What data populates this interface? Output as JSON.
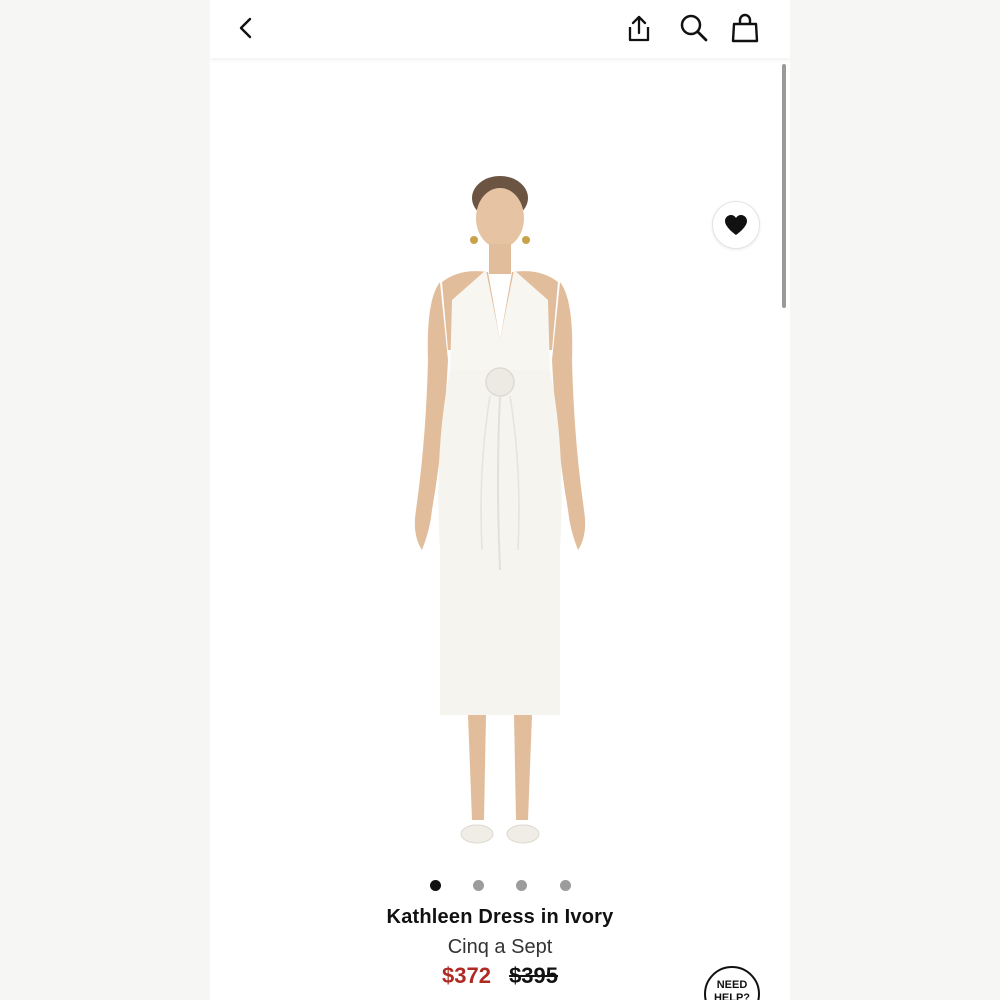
{
  "header": {
    "back_icon": "chevron-left-icon",
    "share_icon": "share-icon",
    "search_icon": "search-icon",
    "bag_icon": "shopping-bag-icon"
  },
  "product": {
    "title": "Kathleen Dress in Ivory",
    "brand": "Cinq a Sept",
    "sale_price": "$372",
    "original_price": "$395",
    "favorite_icon": "heart-icon"
  },
  "carousel": {
    "total": 4,
    "active_index": 0
  },
  "help": {
    "label": "NEED HELP?"
  },
  "colors": {
    "sale_price": "#b02a24",
    "text": "#111111",
    "dot_inactive": "#9c9c9c"
  }
}
